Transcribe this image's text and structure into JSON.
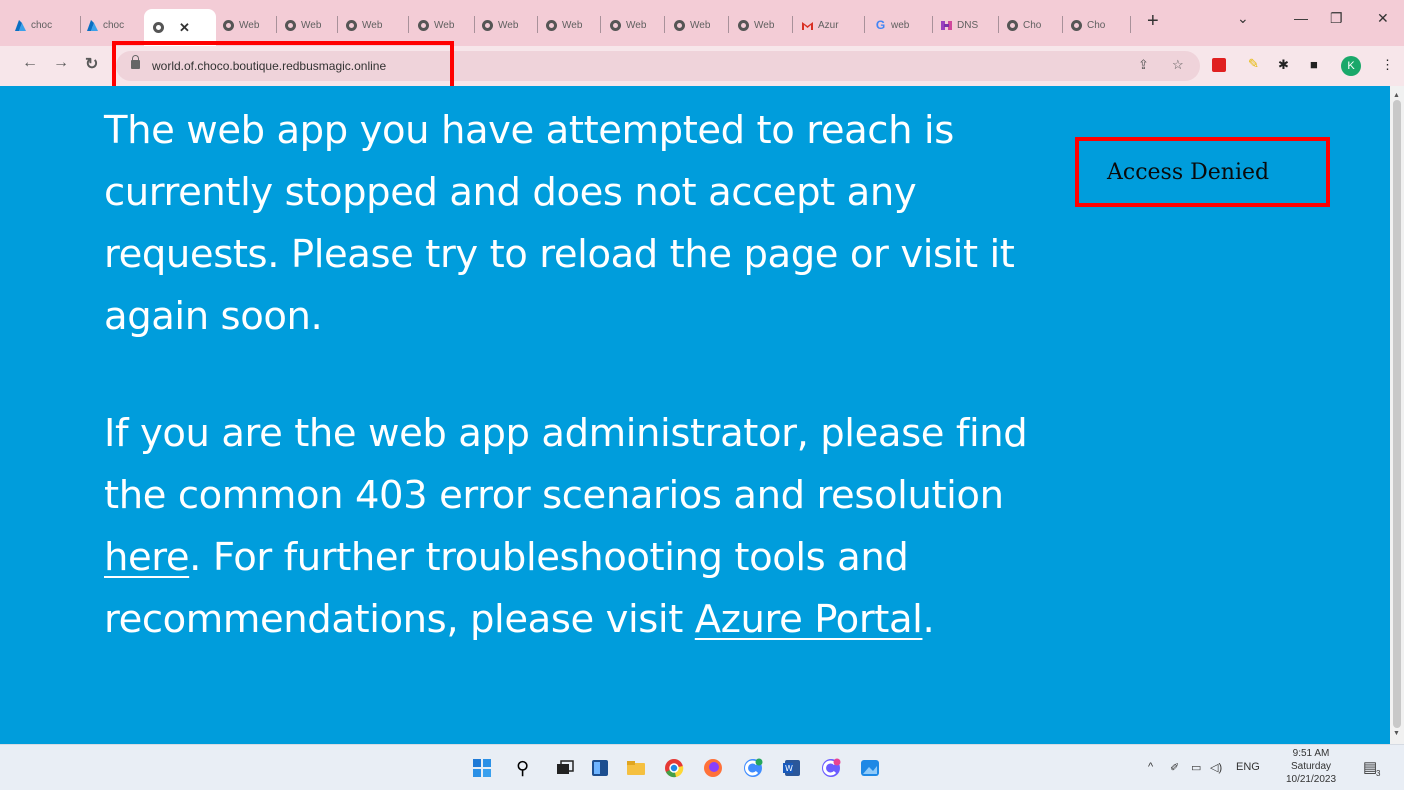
{
  "browser": {
    "tabs": [
      {
        "label": "choc",
        "icon": "azure-icon"
      },
      {
        "label": "choc",
        "icon": "azure-icon"
      },
      {
        "label": "",
        "icon": "globe-icon",
        "active": true
      },
      {
        "label": "Web",
        "icon": "globe-icon"
      },
      {
        "label": "Web",
        "icon": "globe-icon"
      },
      {
        "label": "Web",
        "icon": "globe-icon"
      },
      {
        "label": "Web",
        "icon": "globe-icon"
      },
      {
        "label": "Web",
        "icon": "globe-icon"
      },
      {
        "label": "Web",
        "icon": "globe-icon"
      },
      {
        "label": "Web",
        "icon": "globe-icon"
      },
      {
        "label": "Web",
        "icon": "globe-icon"
      },
      {
        "label": "Web",
        "icon": "globe-icon"
      },
      {
        "label": "Azur",
        "icon": "gmail-icon"
      },
      {
        "label": "web",
        "icon": "google-icon"
      },
      {
        "label": "DNS",
        "icon": "dns-icon"
      },
      {
        "label": "Cho",
        "icon": "globe-icon"
      },
      {
        "label": "Cho",
        "icon": "globe-icon"
      }
    ],
    "new_tab_label": "+",
    "url": "world.of.choco.boutique.redbusmagic.online",
    "profile_initial": "K"
  },
  "page": {
    "paragraph1": "The web app you have attempted to reach is currently stopped and does not accept any requests. Please try to reload the page or visit it again soon.",
    "paragraph2_start": "If you are the web app administrator, please find the common 403 error scenarios and resolution ",
    "link_here": "here",
    "paragraph2_mid": ". For further troubleshooting tools and recommendations, please visit ",
    "link_portal": "Azure Portal",
    "paragraph2_end": "."
  },
  "annotation": {
    "access_label": "Access Denied"
  },
  "taskbar": {
    "language": "ENG",
    "time": "9:51 AM",
    "day": "Saturday",
    "date": "10/21/2023",
    "notification_count": "3"
  },
  "colors": {
    "page_background": "#009ddc",
    "highlight": "#ff0000",
    "tabstrip": "#f3ccd6"
  }
}
